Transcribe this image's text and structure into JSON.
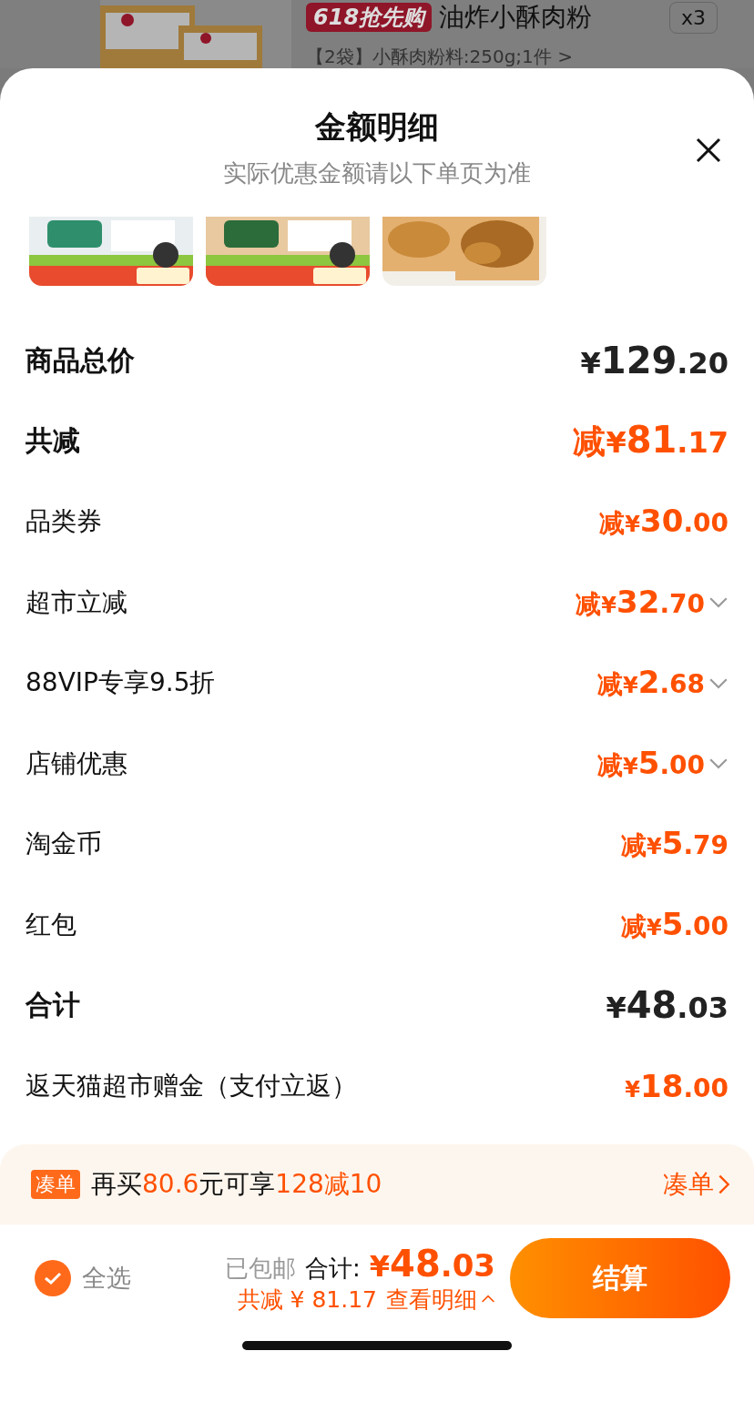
{
  "background_product": {
    "badge": "618抢先购",
    "title": "油炸小酥肉粉",
    "spec": "【2袋】小酥肉粉料:250g;1件 >",
    "quantity": "x3"
  },
  "sheet": {
    "title": "金额明细",
    "subtitle": "实际优惠金额请以下单页为准",
    "rows": [
      {
        "kind": "summary",
        "label": "商品总价",
        "prefix": "",
        "currency": "¥",
        "whole": "129",
        "fraction": ".20",
        "expandable": false
      },
      {
        "kind": "saving",
        "label": "共减",
        "prefix": "减",
        "currency": "¥",
        "whole": "81",
        "fraction": ".17",
        "expandable": false
      },
      {
        "kind": "item",
        "label": "品类券",
        "prefix": "减",
        "currency": "¥",
        "whole": "30",
        "fraction": ".00",
        "expandable": false
      },
      {
        "kind": "item",
        "label": "超市立减",
        "prefix": "减",
        "currency": "¥",
        "whole": "32",
        "fraction": ".70",
        "expandable": true
      },
      {
        "kind": "item",
        "label": "88VIP专享9.5折",
        "prefix": "减",
        "currency": "¥",
        "whole": "2",
        "fraction": ".68",
        "expandable": true
      },
      {
        "kind": "item",
        "label": "店铺优惠",
        "prefix": "减",
        "currency": "¥",
        "whole": "5",
        "fraction": ".00",
        "expandable": true
      },
      {
        "kind": "item",
        "label": "淘金币",
        "prefix": "减",
        "currency": "¥",
        "whole": "5",
        "fraction": ".79",
        "expandable": false
      },
      {
        "kind": "item",
        "label": "红包",
        "prefix": "减",
        "currency": "¥",
        "whole": "5",
        "fraction": ".00",
        "expandable": false
      },
      {
        "kind": "summary",
        "label": "合计",
        "prefix": "",
        "currency": "¥",
        "whole": "48",
        "fraction": ".03",
        "expandable": false
      },
      {
        "kind": "item",
        "label": "返天猫超市赠金（支付立返）",
        "prefix": "",
        "currency": "¥",
        "whole": "18",
        "fraction": ".00",
        "expandable": false
      }
    ]
  },
  "promo_bar": {
    "tag": "凑单",
    "segments": [
      {
        "text": "再买",
        "highlight": false
      },
      {
        "text": "80.6",
        "highlight": true
      },
      {
        "text": "元可享",
        "highlight": false
      },
      {
        "text": "128减10",
        "highlight": true
      }
    ],
    "link": "凑单"
  },
  "footer": {
    "select_all": {
      "label": "全选",
      "checked": true
    },
    "shipping": "已包邮",
    "total_label": "合计:",
    "total_currency": "¥",
    "total_whole": "48",
    "total_fraction": ".03",
    "saving": "共减 ¥ 81.17",
    "details_link": "查看明细",
    "checkout": "结算"
  }
}
